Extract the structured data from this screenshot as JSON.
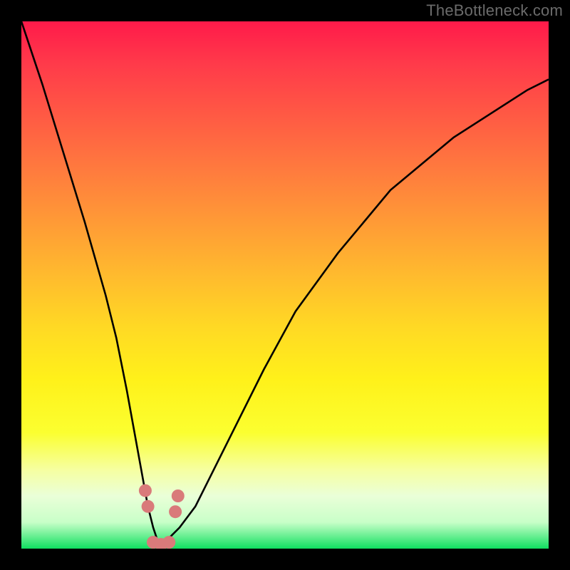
{
  "watermark": "TheBottleneck.com",
  "chart_data": {
    "type": "line",
    "title": "",
    "xlabel": "",
    "ylabel": "",
    "xlim": [
      0,
      100
    ],
    "ylim": [
      0,
      100
    ],
    "grid": false,
    "legend": false,
    "series": [
      {
        "name": "bottleneck-curve",
        "x": [
          0,
          4,
          8,
          12,
          16,
          18,
          20,
          22,
          24,
          25,
          26,
          27,
          28,
          30,
          33,
          36,
          40,
          46,
          52,
          60,
          70,
          82,
          96,
          100
        ],
        "values": [
          100,
          88,
          75,
          62,
          48,
          40,
          30,
          19,
          8,
          4,
          1,
          1,
          2,
          4,
          8,
          14,
          22,
          34,
          45,
          56,
          68,
          78,
          87,
          89
        ]
      }
    ],
    "markers": [
      {
        "name": "left-cluster-marker-1",
        "x": 23.5,
        "y": 11,
        "color": "#d97a7a"
      },
      {
        "name": "left-cluster-marker-2",
        "x": 24.0,
        "y": 8,
        "color": "#d97a7a"
      },
      {
        "name": "right-cluster-marker-1",
        "x": 29.2,
        "y": 7,
        "color": "#d97a7a"
      },
      {
        "name": "right-cluster-marker-2",
        "x": 29.7,
        "y": 10,
        "color": "#d97a7a"
      },
      {
        "name": "bottom-marker-1",
        "x": 25.0,
        "y": 1.2,
        "color": "#d97a7a"
      },
      {
        "name": "bottom-marker-2",
        "x": 26.5,
        "y": 0.8,
        "color": "#d97a7a"
      },
      {
        "name": "bottom-marker-3",
        "x": 28.0,
        "y": 1.2,
        "color": "#d97a7a"
      }
    ]
  }
}
